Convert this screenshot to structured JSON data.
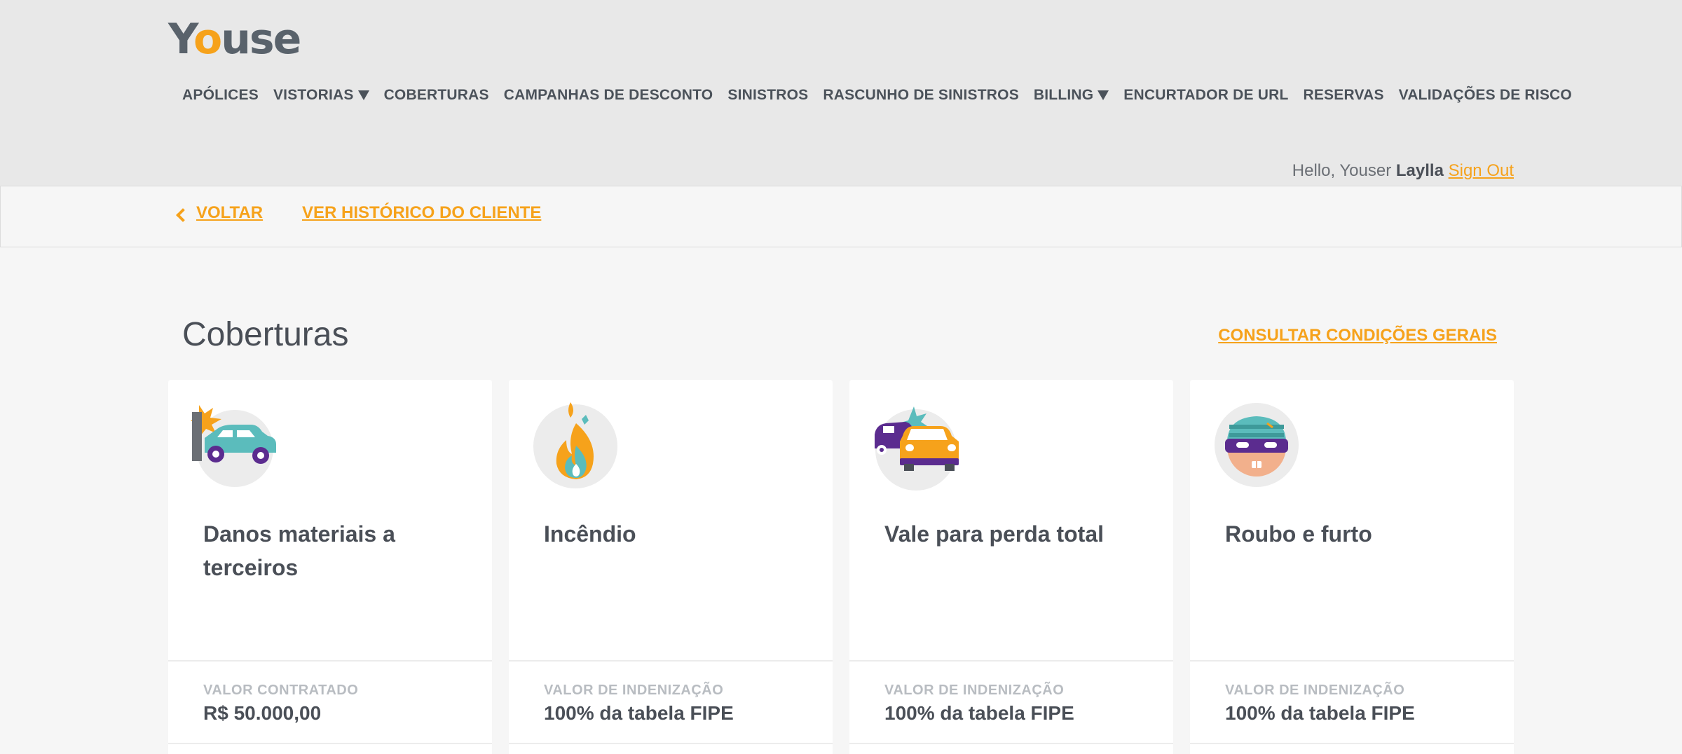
{
  "brand": {
    "logo_pre": "Y",
    "logo_o": "o",
    "logo_post": "use",
    "accent": "#f6a21b"
  },
  "nav": {
    "items": [
      {
        "label": "APÓLICES",
        "dropdown": false
      },
      {
        "label": "VISTORIAS",
        "dropdown": true
      },
      {
        "label": "COBERTURAS",
        "dropdown": false
      },
      {
        "label": "CAMPANHAS DE DESCONTO",
        "dropdown": false
      },
      {
        "label": "SINISTROS",
        "dropdown": false
      },
      {
        "label": "RASCUNHO DE SINISTROS",
        "dropdown": false
      },
      {
        "label": "BILLING",
        "dropdown": true
      },
      {
        "label": "ENCURTADOR DE URL",
        "dropdown": false
      },
      {
        "label": "RESERVAS",
        "dropdown": false
      },
      {
        "label": "VALIDAÇÕES DE RISCO",
        "dropdown": false
      }
    ]
  },
  "user": {
    "greeting": "Hello, Youser",
    "name": "Laylla",
    "sign_out": "Sign Out"
  },
  "subnav": {
    "back": "VOLTAR",
    "history": "VER HISTÓRICO DO CLIENTE"
  },
  "section": {
    "title": "Coberturas",
    "conditions_link": "CONSULTAR CONDIÇÕES GERAIS"
  },
  "cards": [
    {
      "icon": "car-crash-icon",
      "title": "Danos materiais a terceiros",
      "label": "VALOR CONTRATADO",
      "value": "R$ 50.000,00"
    },
    {
      "icon": "fire-icon",
      "title": "Incêndio",
      "label": "VALOR DE INDENIZAÇÃO",
      "value": "100% da tabela FIPE"
    },
    {
      "icon": "car-collision-icon",
      "title": "Vale para perda total",
      "label": "VALOR DE INDENIZAÇÃO",
      "value": "100% da tabela FIPE"
    },
    {
      "icon": "thief-icon",
      "title": "Roubo e furto",
      "label": "VALOR DE INDENIZAÇÃO",
      "value": "100% da tabela FIPE"
    }
  ]
}
